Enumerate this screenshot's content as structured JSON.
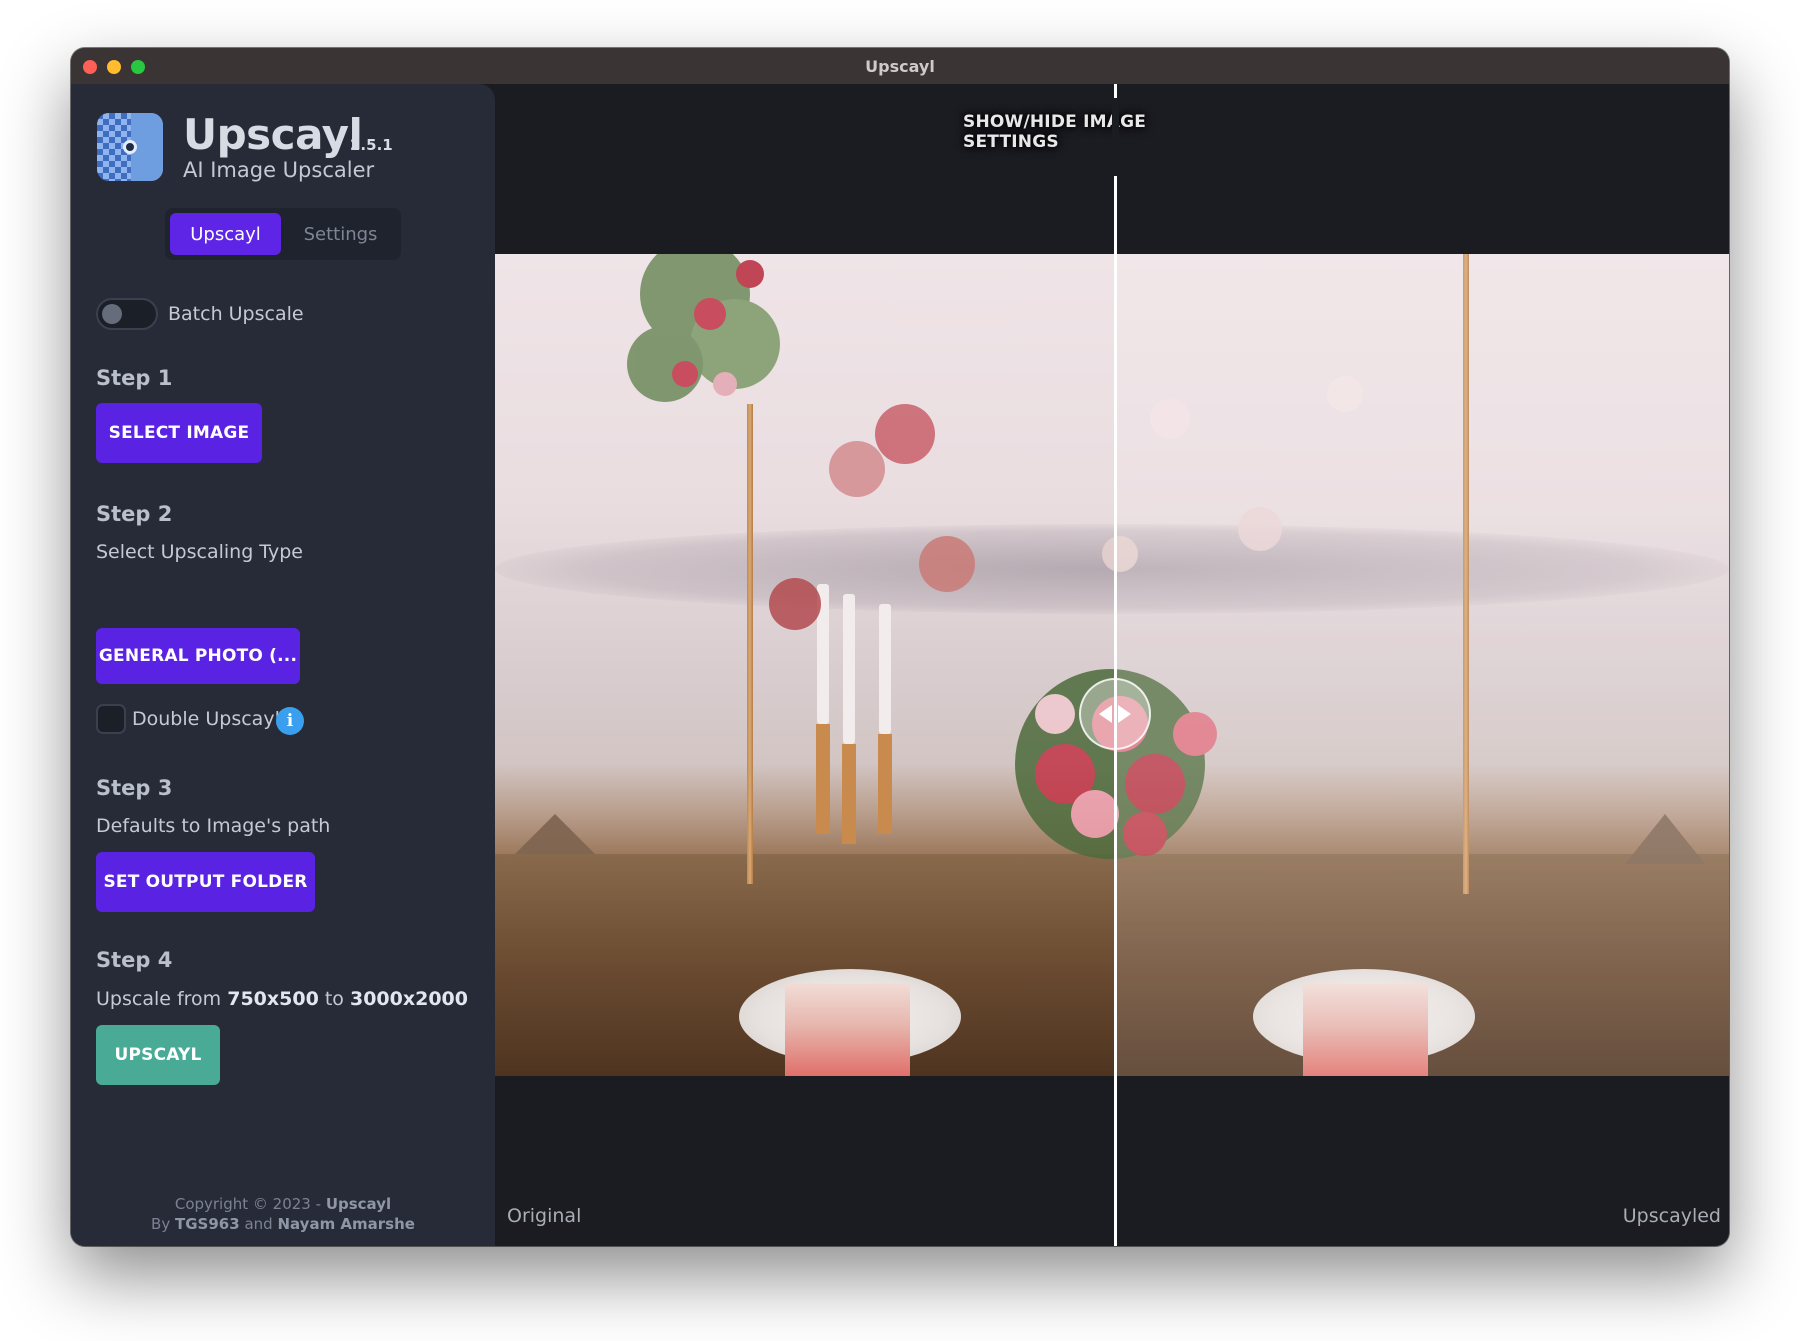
{
  "window": {
    "title": "Upscayl"
  },
  "sidebar": {
    "app_name": "Upscayl",
    "version": "2.5.1",
    "subtitle": "AI Image Upscaler",
    "tabs": [
      {
        "label": "Upscayl",
        "active": true
      },
      {
        "label": "Settings",
        "active": false
      }
    ],
    "batch_toggle": {
      "label": "Batch Upscale",
      "on": false
    },
    "step1": {
      "title": "Step 1",
      "button": "SELECT IMAGE"
    },
    "step2": {
      "title": "Step 2",
      "desc": "Select Upscaling Type",
      "button": "GENERAL PHOTO (...",
      "double_label": "Double Upscayl",
      "double_checked": false,
      "info_glyph": "i"
    },
    "step3": {
      "title": "Step 3",
      "desc": "Defaults to Image's path",
      "button": "SET OUTPUT FOLDER"
    },
    "step4": {
      "title": "Step 4",
      "desc_prefix": "Upscale from",
      "from_res": "750x500",
      "desc_mid": "to",
      "to_res": "3000x2000",
      "button": "UPSCAYL"
    },
    "footer": {
      "copyright_prefix": "Copyright © 2023 -",
      "copyright_name": "Upscayl",
      "by_prefix": "By",
      "author1": "TGS963",
      "and": "and",
      "author2": "Nayam Amarshe"
    }
  },
  "viewer": {
    "settings_toggle": "SHOW/HIDE IMAGE SETTINGS",
    "label_left": "Original",
    "label_right": "Upscayled",
    "slider_position": 0.5
  },
  "icons": {
    "logo": "upscayl-logo-icon",
    "info": "info-icon",
    "slider_handle": "compare-slider-arrows-icon"
  },
  "colors": {
    "accent": "#5a22e2",
    "upscayl_button": "#49ab96",
    "sidebar_bg": "#262b37",
    "viewer_bg": "#1b1b22",
    "info": "#3b9ff0"
  }
}
